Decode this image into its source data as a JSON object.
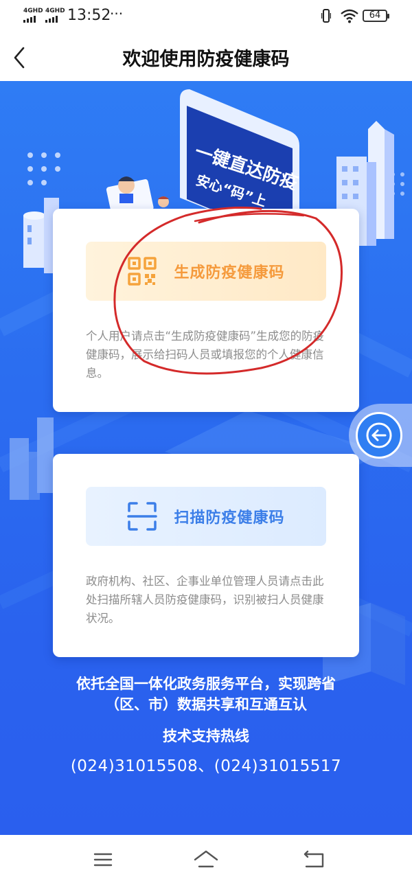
{
  "status_bar": {
    "network_1": "4GHD",
    "network_2": "4GHD",
    "time": "13:52",
    "more": "···",
    "battery": "64"
  },
  "header": {
    "title": "欢迎使用防疫健康码"
  },
  "background": {
    "banner_line1": "一键直达防疫",
    "banner_line2": "安心“码”上"
  },
  "cards": [
    {
      "button_label": "生成防疫健康码",
      "icon": "qr-code-icon",
      "description": "个人用户请点击“生成防疫健康码”生成您的防疫健康码，展示给扫码人员或填报您的个人健康信息。"
    },
    {
      "button_label": "扫描防疫健康码",
      "icon": "scan-frame-icon",
      "description": "政府机构、社区、企事业单位管理人员请点击此处扫描所辖人员防疫健康码，识别被扫人员健康状况。"
    }
  ],
  "footer": {
    "line1": "依托全国一体化政务服务平台，实现跨省",
    "line2": "（区、市）数据共享和互通互认",
    "support_title": "技术支持热线",
    "phones": "(024)31015508、(024)31015517"
  },
  "colors": {
    "primary_blue": "#2b6df0",
    "accent_orange": "#f59a3c",
    "scan_blue": "#3b7ee8",
    "annotation_red": "#d42a2a"
  },
  "system_nav": {
    "menu_icon": "menu-icon",
    "home_icon": "home-icon",
    "back_icon": "return-icon"
  }
}
